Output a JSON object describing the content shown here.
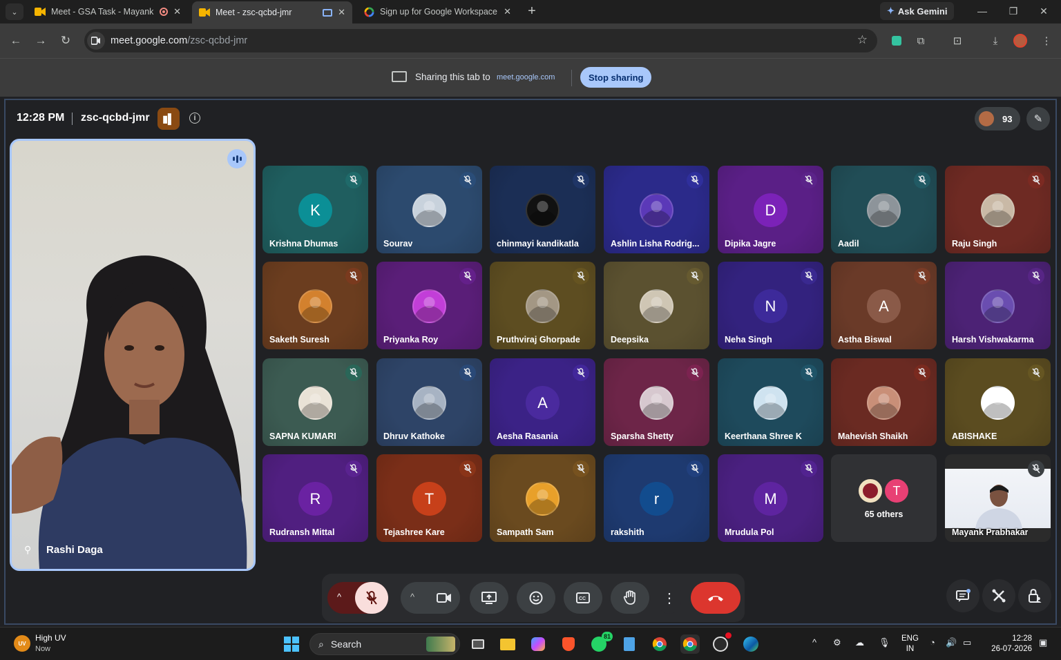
{
  "browser": {
    "tabs": [
      {
        "title": "Meet - GSA Task - Mayank P",
        "active": false,
        "recording": true
      },
      {
        "title": "Meet - zsc-qcbd-jmr",
        "active": true
      },
      {
        "title": "Sign up for Google Workspace",
        "active": false
      }
    ],
    "ask_gemini": "Ask Gemini",
    "url_host": "meet.google.com",
    "url_path": "/zsc-qcbd-jmr"
  },
  "sharing": {
    "text": "Sharing this tab to",
    "target": "meet.google.com",
    "stop_label": "Stop sharing"
  },
  "meet": {
    "time": "12:28 PM",
    "code": "zsc-qcbd-jmr",
    "participants_count": "93",
    "self_name": "Rashi Daga",
    "others_label": "65 others",
    "others_initial": "T",
    "tiles": [
      {
        "name": "Krishna Dhumas",
        "initial": "K",
        "bg": "#1f5e5f",
        "avatar": "#0b8f96",
        "kind": "letter",
        "mute": "#1f6a6a"
      },
      {
        "name": "Sourav",
        "initial": "",
        "bg": "#2c4a6e",
        "avatar": "#c8d2dc",
        "kind": "photo",
        "mute": "#2a4d78"
      },
      {
        "name": "chinmayi kandikatla",
        "initial": "",
        "bg": "#1b2e55",
        "avatar": "#111",
        "kind": "photo",
        "mute": "#1f3566"
      },
      {
        "name": "Ashlin Lisha Rodrig...",
        "initial": "",
        "bg": "#2b2a8a",
        "avatar": "#5b39b8",
        "kind": "photo",
        "mute": "#2f2f9c"
      },
      {
        "name": "Dipika Jagre",
        "initial": "D",
        "bg": "#5a1f86",
        "avatar": "#7b22b8",
        "kind": "letter",
        "mute": "#5b2389"
      },
      {
        "name": "Aadil",
        "initial": "",
        "bg": "#214d56",
        "avatar": "#8d949a",
        "kind": "photo",
        "mute": "#215a64"
      },
      {
        "name": "Raju Singh",
        "initial": "",
        "bg": "#6e2a23",
        "avatar": "#c9b9a6",
        "kind": "photo",
        "mute": "#7c2a22"
      },
      {
        "name": "Saketh Suresh",
        "initial": "",
        "bg": "#6b3d1f",
        "avatar": "#d3812e",
        "kind": "photo",
        "mute": "#7a3a1e"
      },
      {
        "name": "Priyanka Roy",
        "initial": "",
        "bg": "#5a1e78",
        "avatar": "#c23ed8",
        "kind": "photo",
        "mute": "#64208a"
      },
      {
        "name": "Pruthviraj Ghorpade",
        "initial": "",
        "bg": "#5d4d21",
        "avatar": "#a39784",
        "kind": "photo",
        "mute": "#665421"
      },
      {
        "name": "Deepsika",
        "initial": "",
        "bg": "#5b5130",
        "avatar": "#cfc6b4",
        "kind": "photo",
        "mute": "#665a30"
      },
      {
        "name": "Neha Singh",
        "initial": "N",
        "bg": "#33227e",
        "avatar": "#3d2a9a",
        "kind": "letter",
        "mute": "#3a2990"
      },
      {
        "name": "Astha Biswal",
        "initial": "A",
        "bg": "#6a3a28",
        "avatar": "#8a5a48",
        "kind": "letter",
        "mute": "#7a3b26"
      },
      {
        "name": "Harsh Vishwakarma",
        "initial": "",
        "bg": "#4c2275",
        "avatar": "#6a4db0",
        "kind": "photo",
        "mute": "#572585"
      },
      {
        "name": "SAPNA KUMARI",
        "initial": "",
        "bg": "#3c5b52",
        "avatar": "#e9e2d6",
        "kind": "photo",
        "mute": "#2a6658"
      },
      {
        "name": "Dhruv Kathoke",
        "initial": "",
        "bg": "#2e4467",
        "avatar": "#a7b3c3",
        "kind": "photo",
        "mute": "#2a4977"
      },
      {
        "name": "Aesha Rasania",
        "initial": "A",
        "bg": "#3b2286",
        "avatar": "#4a2a9e",
        "kind": "letter",
        "mute": "#42279a"
      },
      {
        "name": "Sparsha Shetty",
        "initial": "",
        "bg": "#6d2548",
        "avatar": "#d7c8cf",
        "kind": "photo",
        "mute": "#7c2350"
      },
      {
        "name": "Keerthana Shree K",
        "initial": "",
        "bg": "#1e4a5c",
        "avatar": "#cfe3f0",
        "kind": "photo",
        "mute": "#1f5468"
      },
      {
        "name": "Mahevish Shaikh",
        "initial": "",
        "bg": "#6a2a22",
        "avatar": "#c98f78",
        "kind": "photo",
        "mute": "#7a2a1f"
      },
      {
        "name": "ABISHAKE",
        "initial": "",
        "bg": "#5b4c20",
        "avatar": "#ffffff",
        "kind": "photo",
        "mute": "#665622"
      },
      {
        "name": "Rudransh Mittal",
        "initial": "R",
        "bg": "#501f80",
        "avatar": "#6a22a2",
        "kind": "letter",
        "mute": "#5a2390"
      },
      {
        "name": "Tejashree Kare",
        "initial": "T",
        "bg": "#7a2e18",
        "avatar": "#c7401a",
        "kind": "letter",
        "mute": "#8a3418"
      },
      {
        "name": "Sampath Sam",
        "initial": "",
        "bg": "#6a4a1f",
        "avatar": "#e8a02a",
        "kind": "photo",
        "mute": "#77521f"
      },
      {
        "name": "rakshith",
        "initial": "r",
        "bg": "#1e3a70",
        "avatar": "#124c8e",
        "kind": "letter",
        "mute": "#21407e"
      },
      {
        "name": "Mrudula Pol",
        "initial": "M",
        "bg": "#4a2080",
        "avatar": "#5e24a0",
        "kind": "letter",
        "mute": "#522390"
      }
    ],
    "mayank_name": "Mayank Prabhakar"
  },
  "taskbar": {
    "weather_title": "High UV",
    "weather_sub": "Now",
    "weather_badge": "UV",
    "search_label": "Search",
    "whatsapp_badge": "81",
    "lang1": "ENG",
    "lang2": "IN",
    "time": "12:28",
    "date": "26-07-2026"
  }
}
